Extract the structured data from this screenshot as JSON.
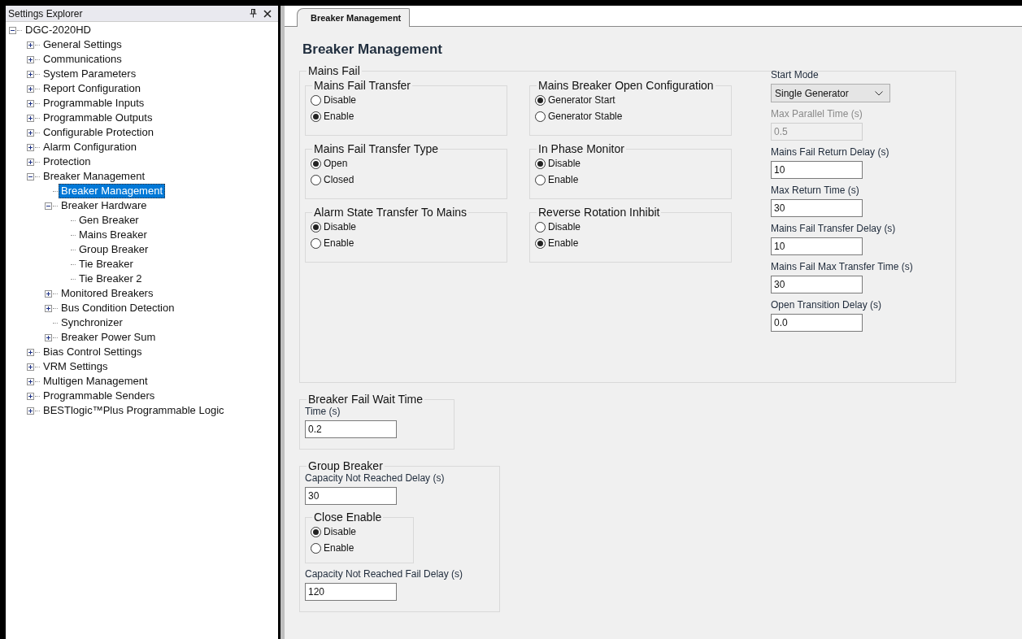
{
  "explorer": {
    "title": "Settings Explorer",
    "tree": [
      {
        "label": "DGC-2020HD",
        "expanded": true,
        "selected": false,
        "children": [
          {
            "label": "General Settings",
            "expanded": false,
            "selected": false
          },
          {
            "label": "Communications",
            "expanded": false,
            "selected": false
          },
          {
            "label": "System Parameters",
            "expanded": false,
            "selected": false
          },
          {
            "label": "Report Configuration",
            "expanded": false,
            "selected": false
          },
          {
            "label": "Programmable Inputs",
            "expanded": false,
            "selected": false
          },
          {
            "label": "Programmable Outputs",
            "expanded": false,
            "selected": false
          },
          {
            "label": "Configurable Protection",
            "expanded": false,
            "selected": false
          },
          {
            "label": "Alarm Configuration",
            "expanded": false,
            "selected": false
          },
          {
            "label": "Protection",
            "expanded": false,
            "selected": false
          },
          {
            "label": "Breaker Management",
            "expanded": true,
            "selected": false,
            "children": [
              {
                "label": "Breaker Management",
                "selected": true
              },
              {
                "label": "Breaker Hardware",
                "expanded": true,
                "selected": false,
                "children": [
                  {
                    "label": "Gen Breaker",
                    "selected": false
                  },
                  {
                    "label": "Mains Breaker",
                    "selected": false
                  },
                  {
                    "label": "Group Breaker",
                    "selected": false
                  },
                  {
                    "label": "Tie Breaker",
                    "selected": false
                  },
                  {
                    "label": "Tie Breaker 2",
                    "selected": false
                  }
                ]
              },
              {
                "label": "Monitored Breakers",
                "expanded": false,
                "selected": false
              },
              {
                "label": "Bus Condition Detection",
                "expanded": false,
                "selected": false
              },
              {
                "label": "Synchronizer",
                "selected": false
              },
              {
                "label": "Breaker Power Sum",
                "expanded": false,
                "selected": false
              }
            ]
          },
          {
            "label": "Bias Control Settings",
            "expanded": false,
            "selected": false
          },
          {
            "label": "VRM Settings",
            "expanded": false,
            "selected": false
          },
          {
            "label": "Multigen Management",
            "expanded": false,
            "selected": false
          },
          {
            "label": "Programmable Senders",
            "expanded": false,
            "selected": false
          },
          {
            "label": "BESTlogic™Plus Programmable Logic",
            "expanded": false,
            "selected": false
          }
        ]
      }
    ]
  },
  "tabs": [
    {
      "label": "Breaker Management",
      "selected": true
    }
  ],
  "heading": "Breaker Management",
  "mains_fail": {
    "title": "Mains Fail",
    "groups": [
      {
        "title": "Mains Fail Transfer",
        "options": [
          {
            "label": "Disable",
            "selected": false
          },
          {
            "label": "Enable",
            "selected": true
          }
        ]
      },
      {
        "title": "Mains Breaker Open Configuration",
        "options": [
          {
            "label": "Generator Start",
            "selected": true
          },
          {
            "label": "Generator Stable",
            "selected": false
          }
        ]
      },
      {
        "title": "Mains Fail Transfer Type",
        "options": [
          {
            "label": "Open",
            "selected": true
          },
          {
            "label": "Closed",
            "selected": false
          }
        ]
      },
      {
        "title": "In Phase Monitor",
        "options": [
          {
            "label": "Disable",
            "selected": true
          },
          {
            "label": "Enable",
            "selected": false
          }
        ]
      },
      {
        "title": "Alarm State Transfer To Mains",
        "options": [
          {
            "label": "Disable",
            "selected": true
          },
          {
            "label": "Enable",
            "selected": false
          }
        ]
      },
      {
        "title": "Reverse Rotation Inhibit",
        "options": [
          {
            "label": "Disable",
            "selected": false
          },
          {
            "label": "Enable",
            "selected": true
          }
        ]
      }
    ],
    "fields": [
      {
        "kind": "dropdown",
        "label": "Start Mode",
        "value": "Single Generator"
      },
      {
        "kind": "text",
        "label": "Max Parallel Time (s)",
        "value": "0.5",
        "disabled": true
      },
      {
        "kind": "text",
        "label": "Mains Fail Return Delay (s)",
        "value": "10",
        "disabled": false
      },
      {
        "kind": "text",
        "label": "Max Return Time (s)",
        "value": "30",
        "disabled": false
      },
      {
        "kind": "text",
        "label": "Mains Fail Transfer Delay (s)",
        "value": "10",
        "disabled": false
      },
      {
        "kind": "text",
        "label": "Mains Fail Max Transfer Time (s)",
        "value": "30",
        "disabled": false
      },
      {
        "kind": "text",
        "label": "Open Transition Delay (s)",
        "value": "0.0",
        "disabled": false
      }
    ]
  },
  "breaker_fail_wait_time": {
    "title": "Breaker Fail Wait Time",
    "items": [
      {
        "kind": "text",
        "label": "Time (s)",
        "value": "0.2",
        "disabled": false
      }
    ]
  },
  "group_breaker": {
    "title": "Group Breaker",
    "items": [
      {
        "kind": "text",
        "label": "Capacity Not Reached Delay (s)",
        "value": "30",
        "disabled": false
      },
      {
        "kind": "radio_group",
        "title": "Close Enable",
        "options": [
          {
            "label": "Disable",
            "selected": true
          },
          {
            "label": "Enable",
            "selected": false
          }
        ]
      },
      {
        "kind": "text",
        "label": "Capacity Not Reached Fail Delay (s)",
        "value": "120",
        "disabled": false
      }
    ]
  }
}
